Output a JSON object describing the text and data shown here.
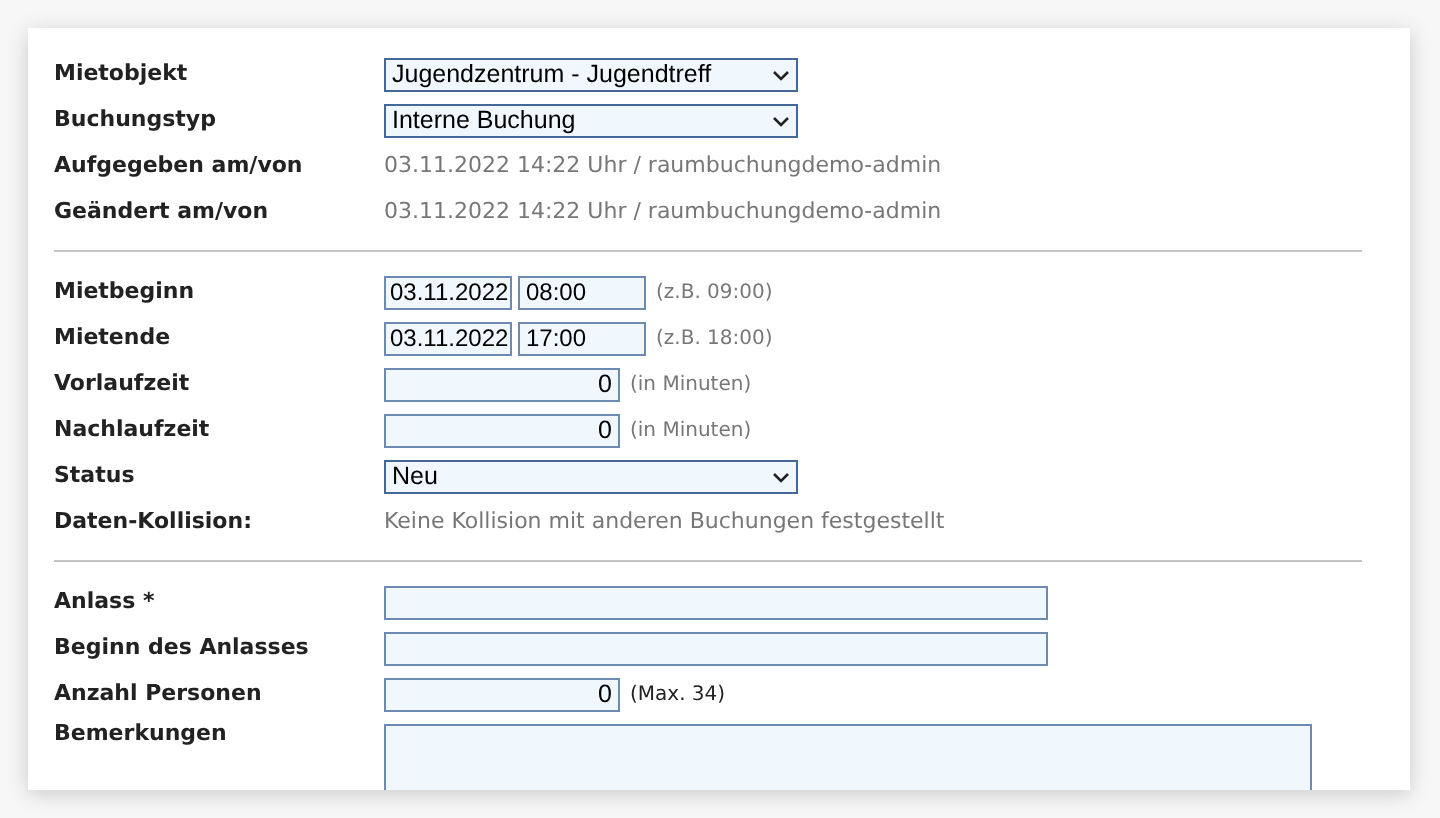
{
  "sections": [
    {
      "rows": [
        {
          "kind": "select",
          "label": "Mietobjekt",
          "value": "Jugendzentrum - Jugendtreff"
        },
        {
          "kind": "select",
          "label": "Buchungstyp",
          "value": "Interne Buchung"
        },
        {
          "kind": "info",
          "label": "Aufgegeben am/von",
          "value": "03.11.2022 14:22 Uhr / raumbuchungdemo-admin"
        },
        {
          "kind": "info",
          "label": "Geändert am/von",
          "value": "03.11.2022 14:22 Uhr / raumbuchungdemo-admin"
        }
      ]
    },
    {
      "rows": [
        {
          "kind": "datetime",
          "label": "Mietbeginn",
          "date": "03.11.2022",
          "time": "08:00",
          "hint": "(z.B. 09:00)"
        },
        {
          "kind": "datetime",
          "label": "Mietende",
          "date": "03.11.2022",
          "time": "17:00",
          "hint": "(z.B. 18:00)"
        },
        {
          "kind": "number",
          "label": "Vorlaufzeit",
          "value": "0",
          "hint": "(in Minuten)"
        },
        {
          "kind": "number",
          "label": "Nachlaufzeit",
          "value": "0",
          "hint": "(in Minuten)"
        },
        {
          "kind": "select",
          "label": "Status",
          "value": "Neu"
        },
        {
          "kind": "info",
          "label": "Daten-Kollision:",
          "value": "Keine Kollision mit anderen Buchungen festgestellt"
        }
      ]
    },
    {
      "rows": [
        {
          "kind": "text",
          "label": "Anlass *"
        },
        {
          "kind": "text",
          "label": "Beginn des Anlasses"
        },
        {
          "kind": "number",
          "label": "Anzahl Personen",
          "value": "0",
          "hint": "(Max. 34)",
          "hint_dark": true
        },
        {
          "kind": "textarea",
          "label": "Bemerkungen"
        }
      ]
    }
  ]
}
